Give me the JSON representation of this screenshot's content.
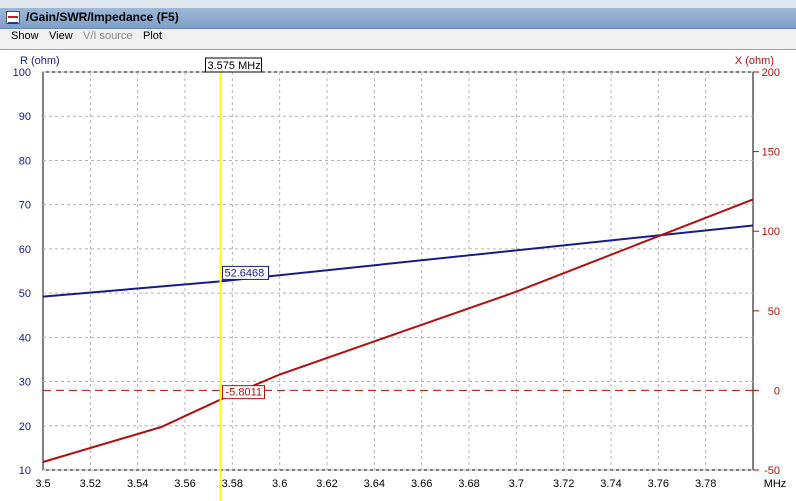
{
  "window": {
    "title": "/Gain/SWR/Impedance (F5)"
  },
  "menu": [
    {
      "label": "Show",
      "disabled": false
    },
    {
      "label": "View",
      "disabled": false
    },
    {
      "label": "V/I source",
      "disabled": true
    },
    {
      "label": "Plot",
      "disabled": false
    }
  ],
  "colors": {
    "resistance": "#1a1a8c",
    "reactance": "#b01010",
    "cursor": "#ffff00"
  },
  "chart_data": {
    "type": "line",
    "x_unit": "MHz",
    "xlim": [
      3.5,
      3.8
    ],
    "x_ticks": [
      3.5,
      3.52,
      3.54,
      3.56,
      3.58,
      3.6,
      3.62,
      3.64,
      3.66,
      3.68,
      3.7,
      3.72,
      3.74,
      3.76,
      3.78
    ],
    "x_tick_labels": [
      "3.5",
      "3.52",
      "3.54",
      "3.56",
      "3.58",
      "3.6",
      "3.62",
      "3.64",
      "3.66",
      "3.68",
      "3.7",
      "3.72",
      "3.74",
      "3.76",
      "3.78"
    ],
    "left_axis": {
      "label": "R (ohm)",
      "ylim": [
        10,
        100
      ],
      "ticks": [
        10,
        20,
        30,
        40,
        50,
        60,
        70,
        80,
        90,
        100
      ]
    },
    "right_axis": {
      "label": "X (ohm)",
      "ylim": [
        -50,
        200
      ],
      "ticks": [
        -50,
        0,
        50,
        100,
        150,
        200
      ]
    },
    "grid": true,
    "series": [
      {
        "axis": "left",
        "x": [
          3.5,
          3.575,
          3.8
        ],
        "y": [
          49.2,
          52.6468,
          65.3
        ]
      },
      {
        "axis": "right",
        "x": [
          3.5,
          3.55,
          3.575,
          3.6,
          3.65,
          3.7,
          3.75,
          3.8
        ],
        "y": [
          -45,
          -23,
          -5.8011,
          10,
          36,
          62,
          91,
          120
        ]
      }
    ],
    "reference_line": {
      "axis": "right",
      "y": 0
    },
    "cursor": {
      "x": 3.575,
      "label": "3.575 MHz",
      "r_value": "52.6468",
      "x_value": "-5.8011"
    }
  }
}
